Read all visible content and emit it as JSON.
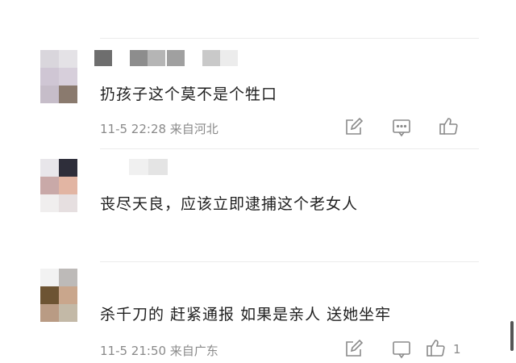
{
  "comments": [
    {
      "text": "扔孩子这个莫不是个牲口",
      "meta": "11-5 22:28 来自河北"
    },
    {
      "text": "丧尽天良，应该立即逮捕这个老女人"
    },
    {
      "text": "杀千刀的 赶紧通报 如果是亲人 送她坐牢",
      "meta": "11-5 21:50 来自广东",
      "likes": "1"
    }
  ],
  "icons": [
    "edit-icon",
    "reply-icon",
    "like-icon"
  ]
}
